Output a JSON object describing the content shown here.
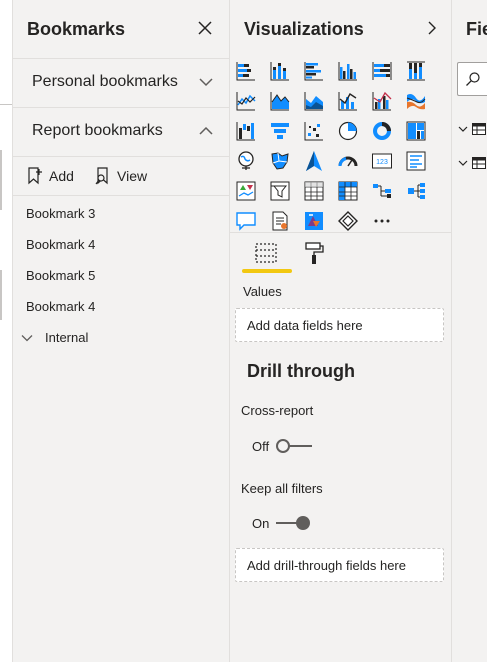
{
  "bookmarks": {
    "title": "Bookmarks",
    "sections": [
      {
        "label": "Personal bookmarks",
        "expanded": false
      },
      {
        "label": "Report bookmarks",
        "expanded": true
      }
    ],
    "actions": [
      {
        "label": "Add",
        "icon": "bookmark-add-icon"
      },
      {
        "label": "View",
        "icon": "bookmark-view-icon"
      }
    ],
    "items": [
      "Bookmark 3",
      "Bookmark 4",
      "Bookmark 5",
      "Bookmark 4"
    ],
    "group": {
      "label": "Internal",
      "expanded": true
    }
  },
  "visualizations": {
    "title": "Visualizations",
    "icons": [
      "stacked-bar-chart-icon",
      "stacked-column-chart-icon",
      "clustered-bar-chart-icon",
      "clustered-column-chart-icon",
      "100-stacked-bar-chart-icon",
      "100-stacked-column-chart-icon",
      "line-chart-icon",
      "area-chart-icon",
      "stacked-area-chart-icon",
      "line-and-stacked-column-chart-icon",
      "line-and-clustered-column-chart-icon",
      "ribbon-chart-icon",
      "waterfall-chart-icon",
      "funnel-chart-icon",
      "scatter-chart-icon",
      "pie-chart-icon",
      "donut-chart-icon",
      "treemap-icon",
      "map-icon",
      "filled-map-icon",
      "azure-map-icon",
      "gauge-icon",
      "card-icon",
      "multi-row-card-icon",
      "kpi-icon",
      "slicer-icon",
      "table-icon",
      "matrix-icon",
      "decomposition-tree-icon",
      "key-influencers-icon",
      "qa-icon",
      "paginated-report-icon",
      "power-apps-icon",
      "power-automate-icon",
      "more-visuals-icon"
    ],
    "tabs": [
      {
        "name": "fields-tab",
        "active": true
      },
      {
        "name": "format-tab",
        "active": false
      }
    ],
    "values_label": "Values",
    "values_placeholder": "Add data fields here",
    "drill_through_heading": "Drill through",
    "cross_report": {
      "label": "Cross-report",
      "state": "Off"
    },
    "keep_all_filters": {
      "label": "Keep all filters",
      "state": "On"
    },
    "drill_placeholder": "Add drill-through fields here"
  },
  "fields": {
    "title": "Fie"
  },
  "colors": {
    "accent_yellow": "#f2c811",
    "icon_blue": "#118dff",
    "icon_dark": "#252423",
    "pane_bg": "#f3f2f1"
  }
}
